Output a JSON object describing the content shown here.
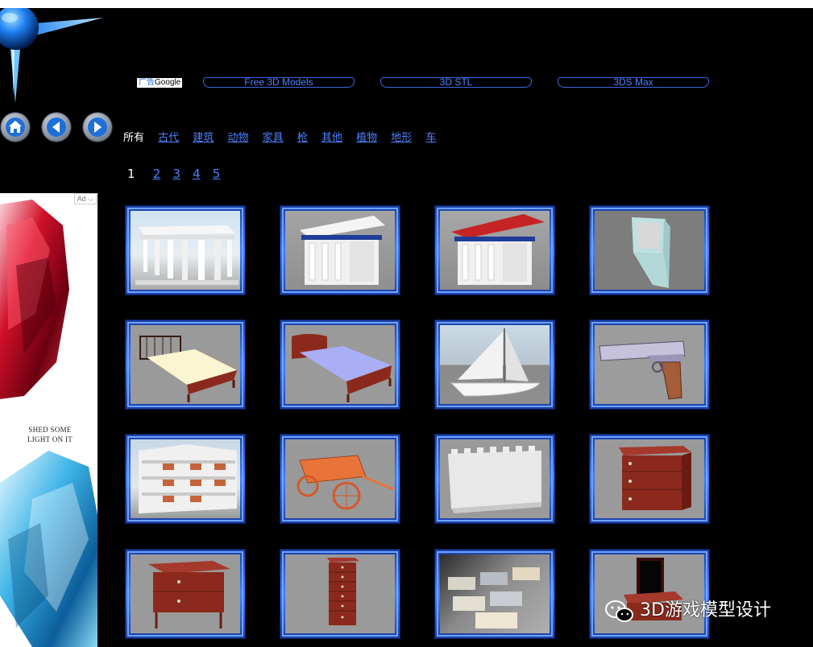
{
  "top_ad_bar": {
    "adchoices_label_cn": "广告",
    "adchoices_label": "Google",
    "links": [
      "Free 3D Models",
      "3D STL",
      "3DS Max"
    ]
  },
  "nav": {
    "home_icon": "home-icon",
    "back_icon": "arrow-left-icon",
    "forward_icon": "arrow-right-icon"
  },
  "categories": {
    "current": "所有",
    "links": [
      "古代",
      "建筑",
      "动物",
      "家具",
      "枪",
      "其他",
      "植物",
      "地形",
      "车"
    ]
  },
  "pagination": {
    "current": "1",
    "pages": [
      "2",
      "3",
      "4",
      "5"
    ]
  },
  "side_ad": {
    "badge": "Ad",
    "headline_line1": "SHED SOME",
    "headline_line2": "LIGHT ON IT"
  },
  "models": [
    {
      "subject": "greek-colonnade"
    },
    {
      "subject": "greek-temple"
    },
    {
      "subject": "greek-temple-red-roof"
    },
    {
      "subject": "crt-monitor"
    },
    {
      "subject": "metal-frame-bed"
    },
    {
      "subject": "wooden-bed"
    },
    {
      "subject": "sailboat"
    },
    {
      "subject": "pistol"
    },
    {
      "subject": "apartment-building"
    },
    {
      "subject": "wooden-cart"
    },
    {
      "subject": "castle-wall"
    },
    {
      "subject": "nightstand"
    },
    {
      "subject": "dresser"
    },
    {
      "subject": "tall-chest-of-drawers"
    },
    {
      "subject": "sofa-set"
    },
    {
      "subject": "vanity-mirror"
    }
  ],
  "watermark": {
    "text": "3D游戏模型设计",
    "icon": "wechat-icon"
  },
  "colors": {
    "background": "#000000",
    "link": "#4d82ff",
    "tile_frame": "#3d7fff"
  }
}
